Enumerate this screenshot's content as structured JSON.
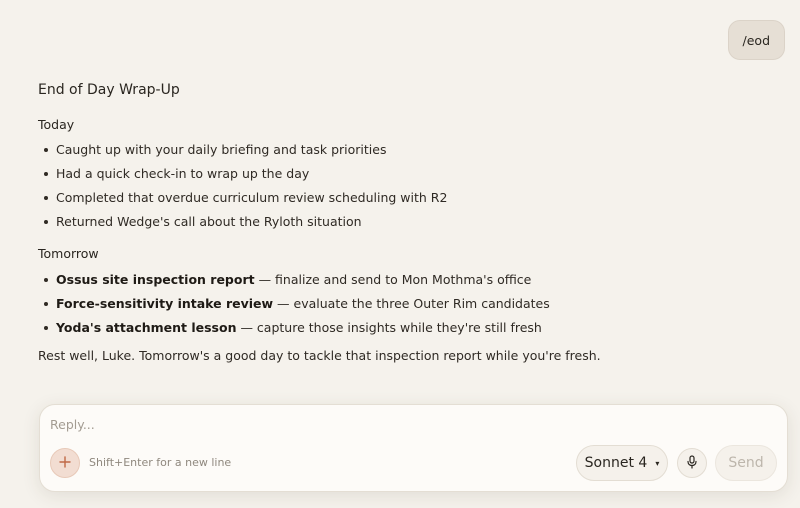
{
  "user_message": {
    "text": "/eod"
  },
  "response": {
    "title": "End of Day Wrap-Up",
    "today": {
      "heading": "Today",
      "items": [
        "Caught up with your daily briefing and task priorities",
        "Had a quick check-in to wrap up the day",
        "Completed that overdue curriculum review scheduling with R2",
        "Returned Wedge's call about the Ryloth situation"
      ]
    },
    "tomorrow": {
      "heading": "Tomorrow",
      "items": [
        {
          "bold": "Ossus site inspection report",
          "rest": " — finalize and send to Mon Mothma's office"
        },
        {
          "bold": "Force-sensitivity intake review",
          "rest": " — evaluate the three Outer Rim candidates"
        },
        {
          "bold": "Yoda's attachment lesson",
          "rest": " — capture those insights while they're still fresh"
        }
      ]
    },
    "closing": "Rest well, Luke. Tomorrow's a good day to tackle that inspection report while you're fresh."
  },
  "composer": {
    "placeholder": "Reply...",
    "add_icon": "plus-icon",
    "hint": "Shift+Enter for a new line",
    "model": "Sonnet 4",
    "model_caret": "▾",
    "mic_icon": "microphone-icon",
    "send_label": "Send"
  },
  "colors": {
    "background": "#f5f2ec",
    "user_bubble": "#e6dfd5",
    "accent": "#c06a47"
  }
}
